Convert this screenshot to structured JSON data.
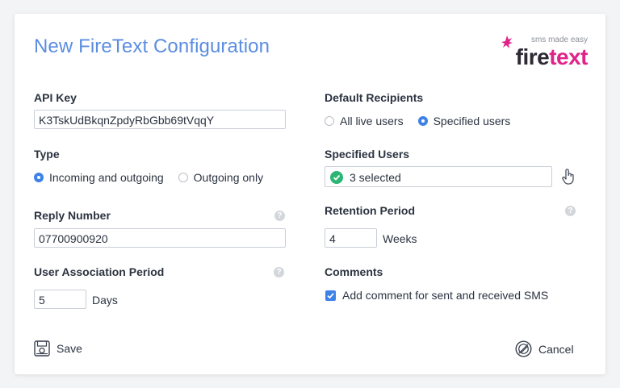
{
  "dialog": {
    "title": "New FireText Configuration",
    "logo": {
      "tagline": "sms made easy",
      "word_dark": "fire",
      "word_pink": "text"
    }
  },
  "form": {
    "api_key": {
      "label": "API Key",
      "value": "K3TskUdBkqnZpdyRbGbb69tVqqY"
    },
    "type": {
      "label": "Type",
      "options": [
        "Incoming and outgoing",
        "Outgoing only"
      ],
      "selected": "Incoming and outgoing"
    },
    "reply_number": {
      "label": "Reply Number",
      "value": "07700900920",
      "help": "?"
    },
    "user_association_period": {
      "label": "User Association Period",
      "value": "5",
      "unit": "Days",
      "help": "?"
    },
    "default_recipients": {
      "label": "Default Recipients",
      "options": [
        "All live users",
        "Specified users"
      ],
      "selected": "Specified users"
    },
    "specified_users": {
      "label": "Specified Users",
      "value": "3 selected"
    },
    "retention_period": {
      "label": "Retention Period",
      "value": "4",
      "unit": "Weeks",
      "help": "?"
    },
    "comments": {
      "label": "Comments",
      "checkbox_label": "Add comment for sent and received SMS",
      "checked": true
    }
  },
  "actions": {
    "save": "Save",
    "cancel": "Cancel"
  },
  "colors": {
    "accent": "#3e82e8",
    "title": "#5b8de0",
    "brand_pink": "#e0238a",
    "success": "#2bb673"
  },
  "icons": [
    "save-icon",
    "cancel-icon",
    "check-icon",
    "pointer-hand-icon",
    "help-icon",
    "firetext-logo"
  ]
}
